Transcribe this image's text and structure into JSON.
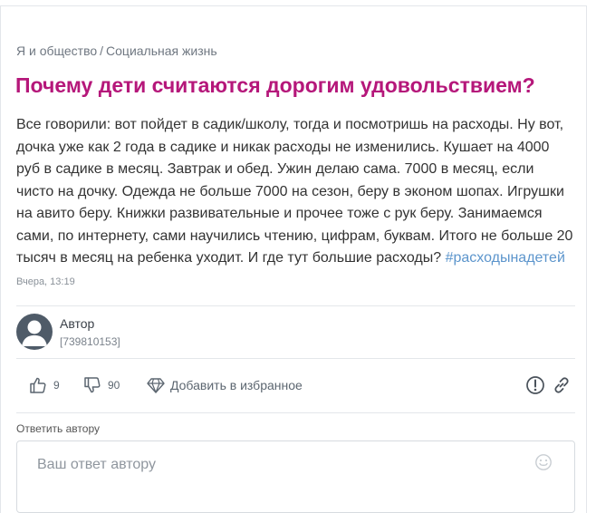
{
  "breadcrumb": {
    "category": "Я и общество",
    "separator": "/",
    "subcategory": "Социальная жизнь"
  },
  "question": {
    "title": "Почему дети считаются дорогим удовольствием?",
    "body": "Все говорили: вот пойдет в садик/школу, тогда и посмотришь на расходы. Ну вот, дочка уже как 2 года в садике и никак расходы не изменились. Кушает на 4000 руб в садике в месяц. Завтрак и обед. Ужин делаю сама. 7000 в месяц, если чисто на дочку. Одежда не больше 7000 на сезон, беру в эконом шопах. Игрушки на авито беру. Книжки развивательные и прочее тоже с рук беру. Занимаемся сами, по интернету, сами научились чтению, цифрам, буквам. Итого не больше 20 тысяч в месяц на ребенка уходит. И где тут большие расходы?",
    "hashtag": "#расходынадетей",
    "timestamp": "Вчера, 13:19"
  },
  "author": {
    "name": "Автор",
    "id": "[739810153]"
  },
  "actions": {
    "likes": "9",
    "dislikes": "90",
    "favorite_label": "Добавить в избранное"
  },
  "reply": {
    "label": "Ответить автору",
    "placeholder": "Ваш ответ автору"
  },
  "colors": {
    "title": "#b5177a",
    "hashtag": "#5c95cc",
    "avatar": "#4f5b68"
  },
  "icons": {
    "like": "thumbs-up-icon",
    "dislike": "thumbs-down-icon",
    "favorite": "diamond-icon",
    "report": "exclamation-circle-icon",
    "link": "link-icon",
    "emoji": "smiley-icon"
  }
}
